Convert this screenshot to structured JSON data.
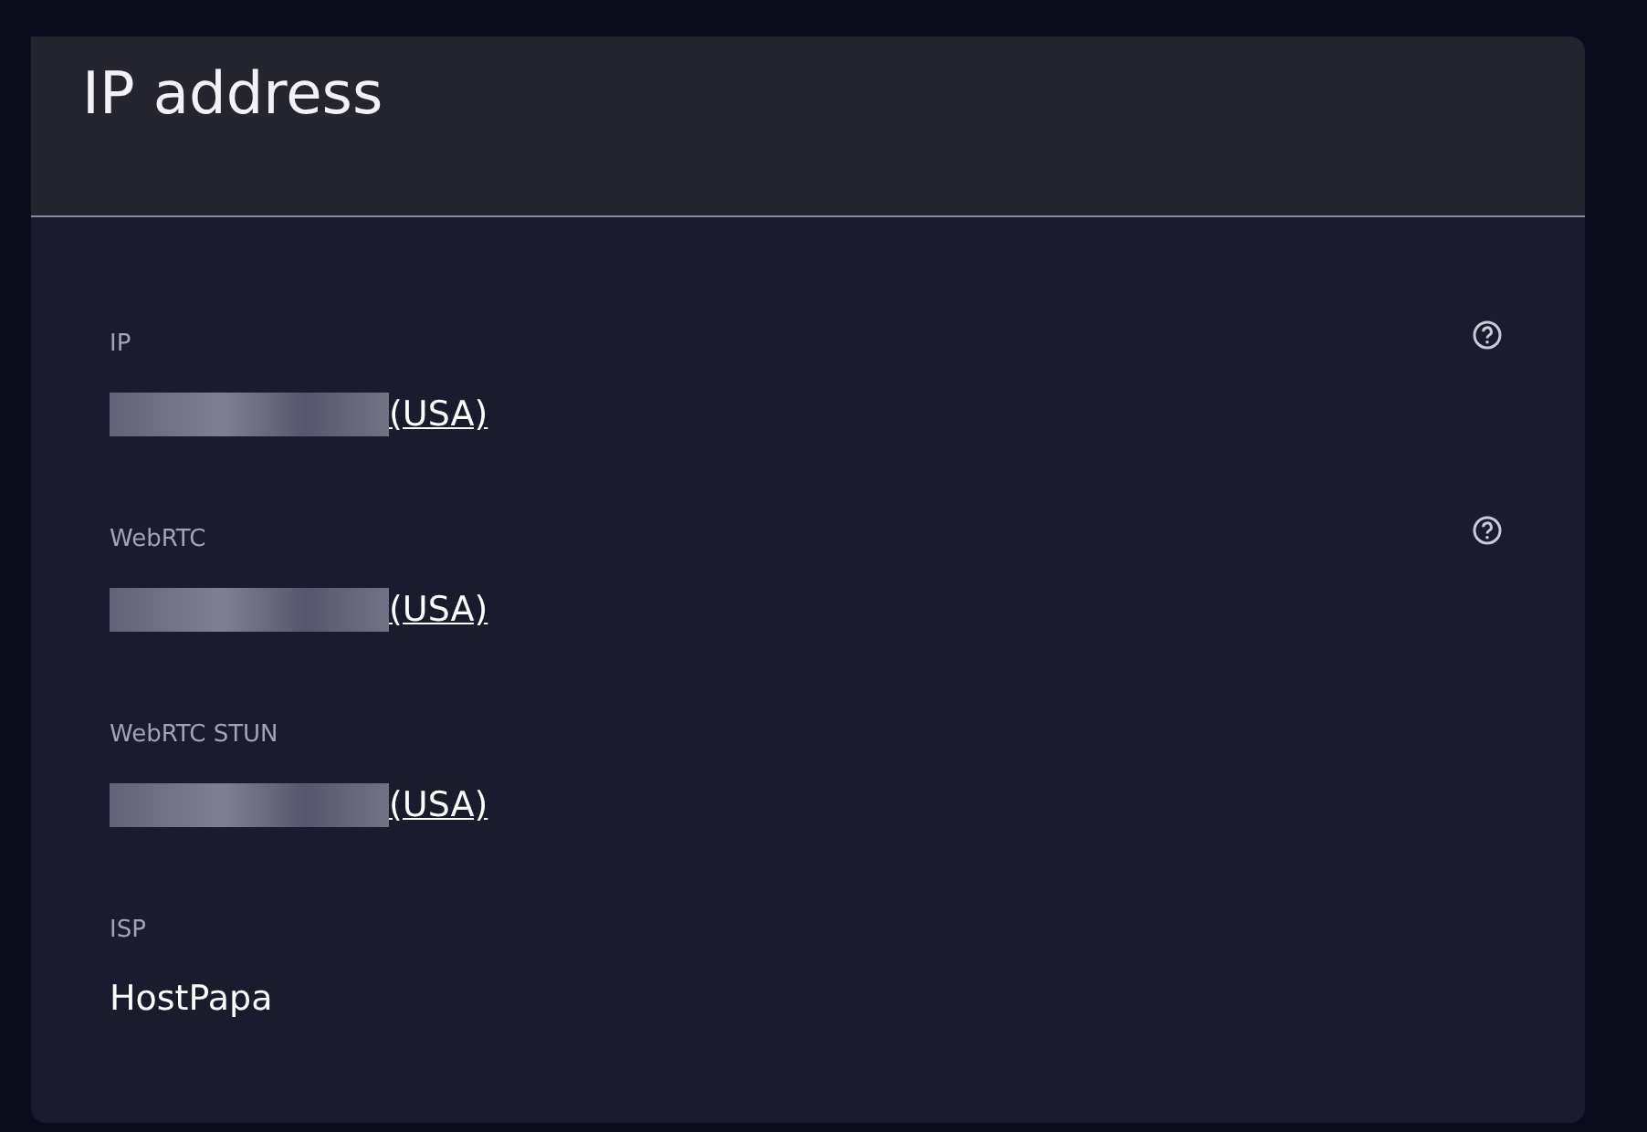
{
  "card": {
    "title": "IP address"
  },
  "fields": [
    {
      "label": "IP",
      "value": "(USA)",
      "redacted": true,
      "link": true,
      "help": true
    },
    {
      "label": "WebRTC",
      "value": "(USA)",
      "redacted": true,
      "link": true,
      "help": true
    },
    {
      "label": "WebRTC STUN",
      "value": "(USA)",
      "redacted": true,
      "link": true,
      "help": false
    },
    {
      "label": "ISP",
      "value": "HostPapa",
      "redacted": false,
      "link": false,
      "help": false
    }
  ]
}
